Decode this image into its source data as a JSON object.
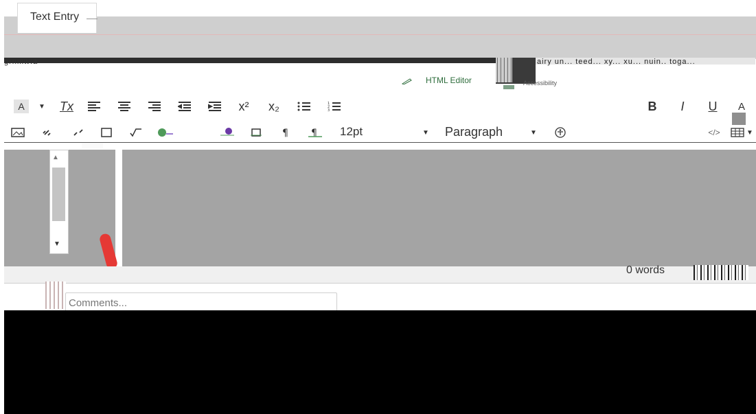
{
  "tabs": [
    {
      "label": "Text Entry"
    }
  ],
  "header": {
    "glitch_left": "grnmw:a",
    "glitch_right": "airy un... teed... xy... xu... nuin.. toga..."
  },
  "editor_toggle": {
    "label": "HTML Editor",
    "mini_label": "Accessibility"
  },
  "toolbar": {
    "row1": {
      "background_color": "A",
      "clear_formatting": "Tx",
      "superscript": "x²",
      "subscript": "x₂",
      "bold": "B",
      "italic": "I",
      "underline": "U",
      "text_color": "A"
    },
    "row2": {
      "font_size": "12pt",
      "paragraph": "Paragraph",
      "table_icon": "table-icon"
    }
  },
  "status": {
    "word_count": "0 words"
  },
  "comments": {
    "placeholder": "Comments..."
  },
  "colors": {
    "tab_strip": "#cfcfcf",
    "editor_area": "#a4a4a4",
    "accent_green": "#2d6c3b",
    "resize_pen": "#e53935",
    "black_region": "#000000"
  }
}
